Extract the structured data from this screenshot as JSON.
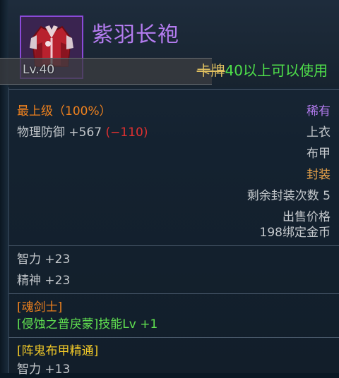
{
  "item": {
    "name": "紫羽长袍",
    "level": "Lv.40",
    "requirement_struck": "卡牌",
    "requirement": "40以上可以使用",
    "grade": "最上级（100%）",
    "rarity": "稀有",
    "defense_label": "物理防御 +567",
    "defense_diff": "(−110)",
    "slot": "上衣",
    "armor_type": "布甲",
    "sealed": "封装",
    "seal_remaining": "剩余封装次数 5",
    "sell_label": "出售价格",
    "sell_price": "198绑定金币"
  },
  "stats": [
    "智力 +23",
    "精神 +23"
  ],
  "class_bonus": {
    "class": "[魂剑士]",
    "skill": "[侵蚀之普戾蒙]技能Lv +1"
  },
  "mastery": {
    "title": "[阵鬼布甲精通]",
    "stat": "智力 +13"
  },
  "colors": {
    "name": "#b47cf0",
    "grade": "#f0821e",
    "green": "#60e050",
    "negative": "#e03030",
    "seal": "#e8a34a"
  },
  "icons": {
    "item": "purple-robe-icon"
  }
}
